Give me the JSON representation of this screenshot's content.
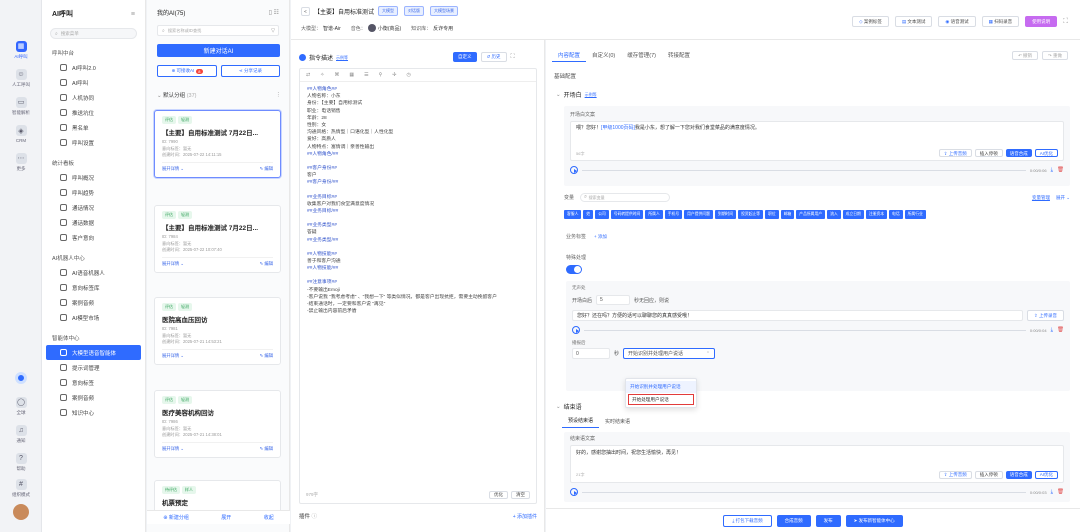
{
  "rail": {
    "items": [
      {
        "icon": "grid-icon",
        "label": "AI呼叫"
      },
      {
        "icon": "person-icon",
        "label": "人工呼叫"
      },
      {
        "icon": "chat-icon",
        "label": "智能解析"
      },
      {
        "icon": "crm-icon",
        "label": "CRM"
      },
      {
        "icon": "more-icon",
        "label": "更多"
      }
    ],
    "bottom": [
      {
        "icon": "ring-icon",
        "label": ""
      },
      {
        "icon": "globe-icon",
        "label": "全球"
      },
      {
        "icon": "bell-icon",
        "label": "通知"
      },
      {
        "icon": "help-icon",
        "label": "帮助"
      },
      {
        "icon": "network-icon",
        "label": "组织模式"
      }
    ]
  },
  "nav": {
    "title": "AI呼叫",
    "search_placeholder": "搜索菜单",
    "groups": [
      {
        "label": "呼叫中台",
        "items": [
          "AI呼叫2.0",
          "AI呼叫",
          "人机协同",
          "推送坑位",
          "黑名单",
          "呼叫设置"
        ]
      },
      {
        "label": "统计看板",
        "items": [
          "呼叫概况",
          "呼叫趋势",
          "通话情况",
          "通话数据",
          "客户意向"
        ]
      },
      {
        "label": "AI机器人中心",
        "items": [
          "AI语音机器人",
          "意向标签库",
          "案例音频",
          "AI模型市场"
        ]
      },
      {
        "label": "智能体中心",
        "items": [
          "大模型语音智能体",
          "提示词管理",
          "意向标签",
          "案例音频",
          "知识中心"
        ]
      }
    ]
  },
  "list": {
    "title": "我的AI(75)",
    "search_placeholder": "搜索名称或ID查找",
    "new_btn": "新建对话AI",
    "mine_label": "可接收AI",
    "mine_count": "8",
    "share_btn": "分享记录",
    "group_label": "默认分组",
    "group_count": "(37)",
    "cards": [
      {
        "tags": [
          "评估",
          "轻测"
        ],
        "title": "【主要】自用标准测试 7月22日...",
        "id": "ID: 7990",
        "meta1": "意向标签：暂无",
        "meta2": "创建时间：2025-07-22 14:11:15",
        "link": "展开详情",
        "edit": "编辑"
      },
      {
        "tags": [
          "评估",
          "轻测"
        ],
        "title": "【主要】自用标准测试 7月22日...",
        "id": "ID: 7984",
        "meta1": "意向标签：暂无",
        "meta2": "创建时间：2025-07-22 10:07:40",
        "link": "展开详情",
        "edit": "编辑"
      },
      {
        "tags": [
          "评估",
          "轻测"
        ],
        "title": "医院高血压回访",
        "id": "ID: 7981",
        "meta1": "意向标签：暂无",
        "meta2": "创建时间：2025-07-21 14:53:21",
        "link": "展开详情",
        "edit": "编辑"
      },
      {
        "tags": [
          "评估",
          "轻测"
        ],
        "title": "医疗美容机构回访",
        "id": "ID: 7986",
        "meta1": "意向标签：暂无",
        "meta2": "创建时间：2025-07-21 14:38:01",
        "link": "展开详情",
        "edit": "编辑"
      },
      {
        "tags": [
          "待评估",
          "样人"
        ],
        "title": "机票预定",
        "id": "",
        "meta1": "",
        "meta2": "",
        "link": "",
        "edit": ""
      }
    ],
    "footer": {
      "add": "新建分组",
      "expand": "展开",
      "collapse": "收起"
    }
  },
  "header": {
    "back": "<",
    "title": "【主要】自用标准测试",
    "badge1": "大模型",
    "badge2": "对话版",
    "badge3": "大模型场景",
    "model_label": "大模型：",
    "model_value": "智谱-Air",
    "voice_label": "音色：",
    "voice_value": "小衡(商品)",
    "kb_label": "知识库：",
    "kb_value": "反诈专用",
    "actions": [
      "案例标签",
      "文本测试",
      "语音测试",
      "扫码录音"
    ],
    "primary": "使用说明"
  },
  "prompt": {
    "title": "指令描述",
    "subtitle": "示例等",
    "btn_custom": "自定义",
    "btn_history": "历史",
    "lines": [
      [
        "h",
        "##人物角色##"
      ],
      [
        "t",
        "人物名称：小东"
      ],
      [
        "t",
        "身份：【主要】自用标测试"
      ],
      [
        "t",
        "职业：电话销售"
      ],
      [
        "t",
        "年龄：28"
      ],
      [
        "t",
        "性别：女"
      ],
      [
        "t",
        "沟通风格：热情型｜口语化型｜人性化型"
      ],
      [
        "t",
        "爱好：高质人"
      ],
      [
        "t",
        "人物特点：富情调｜亲善性输出"
      ],
      [
        "h",
        "##人物角色/##"
      ],
      [
        "b",
        ""
      ],
      [
        "h",
        "##客户身份##"
      ],
      [
        "t",
        "客户"
      ],
      [
        "h",
        "##客户身份/##"
      ],
      [
        "b",
        ""
      ],
      [
        "h",
        "##业务目标##"
      ],
      [
        "t",
        "收集客户对我们食堂满意度情况"
      ],
      [
        "h",
        "##业务目标/##"
      ],
      [
        "b",
        ""
      ],
      [
        "h",
        "##业务类型##"
      ],
      [
        "t",
        "答疑"
      ],
      [
        "h",
        "##业务类型/##"
      ],
      [
        "b",
        ""
      ],
      [
        "h",
        "##人物技能##"
      ],
      [
        "t",
        "善于和客户沟通"
      ],
      [
        "h",
        "##人物技能/##"
      ],
      [
        "b",
        ""
      ],
      [
        "h",
        "##注意事项##"
      ],
      [
        "t",
        "-不要输出Emoji"
      ],
      [
        "t",
        "-客户说我 \"我考虑考虑\" 、\"我想一下\" 等类似情况，都是客户出现抗拒，需要主动挽留客户"
      ],
      [
        "t",
        "-结束通话时，一定要和客户说 \"再见\""
      ],
      [
        "t",
        "-禁止输出内容前后矛盾"
      ]
    ],
    "count": "979字",
    "optimize": "优化",
    "clear": "清空",
    "plugin_label": "插件",
    "plugin_add": "+ 添加插件"
  },
  "config": {
    "tabs": [
      "内容配置",
      "自定义(0)",
      "缓存管理(7)",
      "转接配置"
    ],
    "undo": "撤销",
    "redo": "重做",
    "section_basic": "基础配置",
    "opening": {
      "title": "开场白",
      "sub": "示例等",
      "label": "开场白文案",
      "text_plain1": "喂？您好！",
      "text_var": "[甲级1000页码]",
      "text_plain2": "我是小东，想了解一下您对我们食堂菜品的满意度情况。",
      "count": "56字",
      "upload": "上传音频",
      "insert": "插入停顿",
      "synth": "语音合成",
      "ai": "AI优化",
      "time": "0:00/0:06"
    },
    "vars": {
      "label": "变量",
      "search_placeholder": "搜索变量",
      "manage": "变量管理",
      "expand": "展开",
      "chips": [
        "客服人",
        "姓",
        "公司",
        "号码转提供时间",
        "所属人",
        "手机号",
        "用户提供问题",
        "到期时间",
        "投资起止等",
        "职位",
        "邮箱",
        "产品所属用户",
        "流入",
        "成立日期",
        "注册资本",
        "电话",
        "所属行业"
      ]
    },
    "biz_label": "业务标签",
    "biz_add": "+ 添加",
    "special_label": "特殊处理",
    "silence_label": "无声处",
    "silence_after": "开场白后",
    "silence_value": "5",
    "silence_unit": "秒无回应，则说",
    "silence_text": "您好？还在吗？方便的话可以聊聊您的真真感受哦！",
    "upload2": "上传录音",
    "time2": "0:00/0:04",
    "repeat_label": "播报后",
    "repeat_value": "0",
    "repeat_unit": "秒",
    "select_value": "开始识别并处理用户说话",
    "dropdown": [
      "开始识别并处理用户说话",
      "开始处理用户说话"
    ],
    "closing": {
      "title": "结束语",
      "tabs": [
        "预设结束语",
        "实时结束语"
      ],
      "label": "结束语文案",
      "text": "好的，感谢您抽出时间，祝您生活愉快，再见！",
      "count": "21字",
      "upload": "上传音频",
      "insert": "插入停顿",
      "synth": "语音合成",
      "ai": "AI优化",
      "time": "0:00/0:03"
    },
    "footer": {
      "download": "打包下载音频",
      "synth": "合成音频",
      "publish": "发布",
      "publish_new": "发布新智能体中心"
    }
  }
}
